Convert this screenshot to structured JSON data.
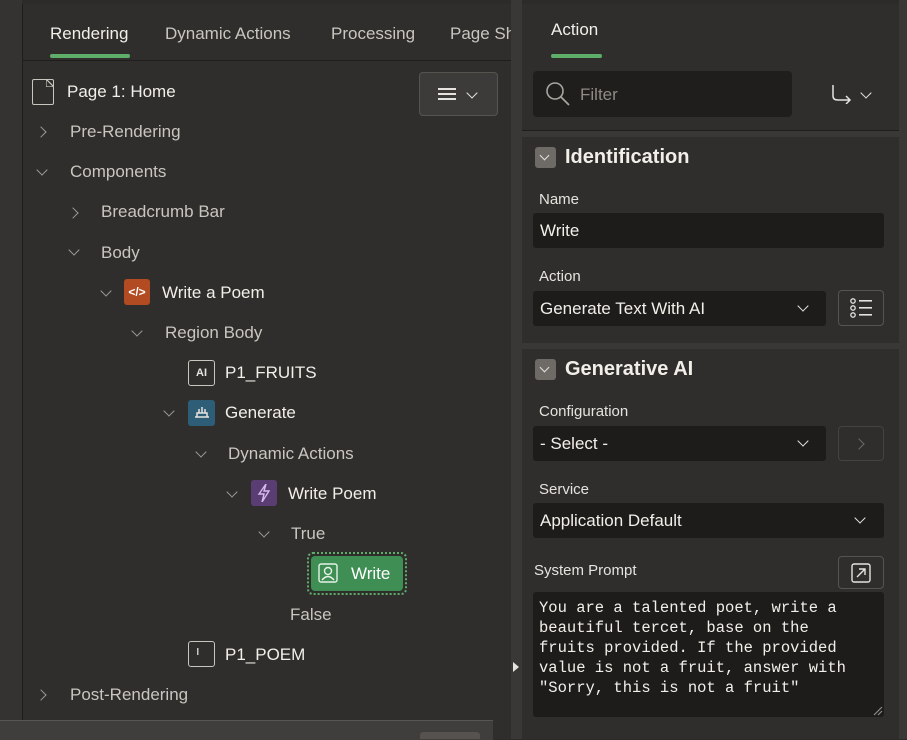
{
  "tabs": {
    "rendering": "Rendering",
    "dynamic_actions": "Dynamic Actions",
    "processing": "Processing",
    "page_shared": "Page Sh",
    "action": "Action"
  },
  "tree": {
    "page": "Page 1: Home",
    "pre_rendering": "Pre-Rendering",
    "components": "Components",
    "breadcrumb_bar": "Breadcrumb Bar",
    "body": "Body",
    "write_a_poem": "Write a Poem",
    "region_body": "Region Body",
    "p1_fruits": "P1_FRUITS",
    "generate": "Generate",
    "dynamic_actions": "Dynamic Actions",
    "write_poem": "Write Poem",
    "true_label": "True",
    "write": "Write",
    "false_label": "False",
    "p1_poem": "P1_POEM",
    "post_rendering": "Post-Rendering"
  },
  "filter": {
    "placeholder": "Filter"
  },
  "identification": {
    "title": "Identification",
    "name_label": "Name",
    "name_value": "Write",
    "action_label": "Action",
    "action_value": "Generate Text With AI"
  },
  "generative_ai": {
    "title": "Generative AI",
    "configuration_label": "Configuration",
    "configuration_value": "- Select -",
    "service_label": "Service",
    "service_value": "Application Default",
    "system_prompt_label": "System Prompt",
    "system_prompt_value": "You are a talented poet, write a\nbeautiful tercet, base on the\nfruits provided. If the provided\nvalue is not a fruit, answer with\n\"Sorry, this is not a fruit\""
  },
  "colors": {
    "accent": "#5eae6a",
    "panel": "#2f2e2c",
    "field": "#1d1c1b"
  }
}
